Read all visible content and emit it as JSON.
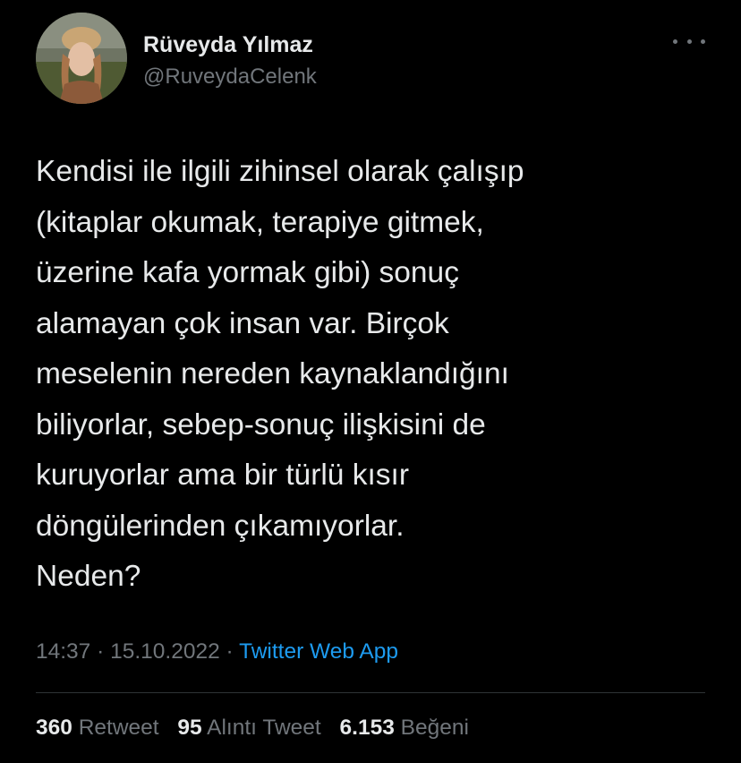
{
  "author": {
    "name": "Rüveyda Yılmaz",
    "handle": "@RuveydaCelenk"
  },
  "icons": {
    "more": "more-horizontal-icon",
    "avatar": "profile-photo"
  },
  "tweet": {
    "lines": [
      "Kendisi ile ilgili zihinsel olarak çalışıp",
      "(kitaplar okumak, terapiye gitmek,",
      "üzerine kafa yormak gibi) sonuç",
      "alamayan çok insan var. Birçok",
      "meselenin nereden kaynaklandığını",
      "biliyorlar, sebep-sonuç ilişkisini de",
      "kuruyorlar ama bir türlü kısır",
      "döngülerinden çıkamıyorlar.",
      "Neden?"
    ],
    "time": "14:37",
    "separator": "·",
    "date": "15.10.2022",
    "source": "Twitter Web App"
  },
  "stats": {
    "retweets": {
      "count": "360",
      "label": "Retweet"
    },
    "quotes": {
      "count": "95",
      "label": "Alıntı Tweet"
    },
    "likes": {
      "count": "6.153",
      "label": "Beğeni"
    }
  },
  "colors": {
    "background": "#000000",
    "text": "#e7e9ea",
    "secondary": "#71767b",
    "link": "#1d9bf0",
    "divider": "#2f3336"
  }
}
